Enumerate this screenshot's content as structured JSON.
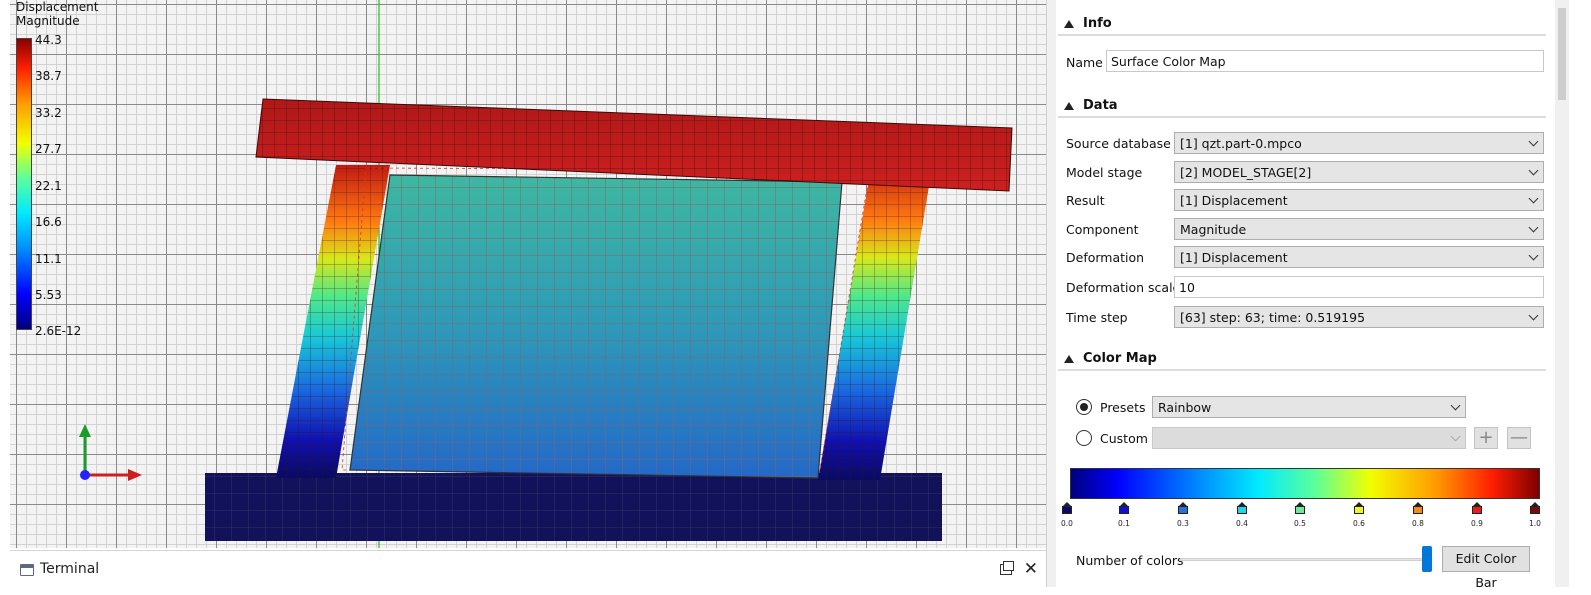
{
  "viewport": {
    "legend": {
      "title_line1": "Displacement",
      "title_line2": "Magnitude",
      "ticks": [
        "44.3",
        "38.7",
        "33.2",
        "27.7",
        "22.1",
        "16.6",
        "11.1",
        "5.53",
        "2.6E-12"
      ]
    },
    "triad": {
      "x_axis_color": "#cc1f1f",
      "y_axis_color": "#1a9c2a",
      "origin_color": "#2323ff"
    }
  },
  "terminal": {
    "title": "Terminal",
    "icon": "terminal-icon",
    "float_icon": "float-window-icon",
    "close_icon": "close-icon",
    "close_glyph": "✕"
  },
  "panel": {
    "info": {
      "header": "Info",
      "name_label": "Name",
      "name_value": "Surface Color Map"
    },
    "data": {
      "header": "Data",
      "source_database_label": "Source database",
      "source_database_value": "[1] qzt.part-0.mpco",
      "model_stage_label": "Model stage",
      "model_stage_value": "[2] MODEL_STAGE[2]",
      "result_label": "Result",
      "result_value": "[1] Displacement",
      "component_label": "Component",
      "component_value": "Magnitude",
      "deformation_label": "Deformation",
      "deformation_value": "[1] Displacement",
      "deformation_scale_label": "Deformation scale",
      "deformation_scale_value": "10",
      "time_step_label": "Time step",
      "time_step_value": "[63] step: 63; time: 0.519195"
    },
    "color_map": {
      "header": "Color Map",
      "presets_label": "Presets",
      "presets_value": "Rainbow",
      "presets_selected": true,
      "custom_label": "Custom",
      "add_glyph": "+",
      "remove_glyph": "—",
      "stops": [
        "0.0",
        "0.1",
        "0.3",
        "0.4",
        "0.5",
        "0.6",
        "0.8",
        "0.9",
        "1.0"
      ],
      "stop_colors": [
        "#0a0a6e",
        "#1010d8",
        "#2a6fe0",
        "#1fd6e6",
        "#6fe89a",
        "#f2f22a",
        "#f08a1c",
        "#e81c1c",
        "#7a0a0a"
      ],
      "number_of_colors_label": "Number of colors",
      "number_of_colors_level": 1.0,
      "edit_button_label": "Edit Color Bar"
    }
  }
}
